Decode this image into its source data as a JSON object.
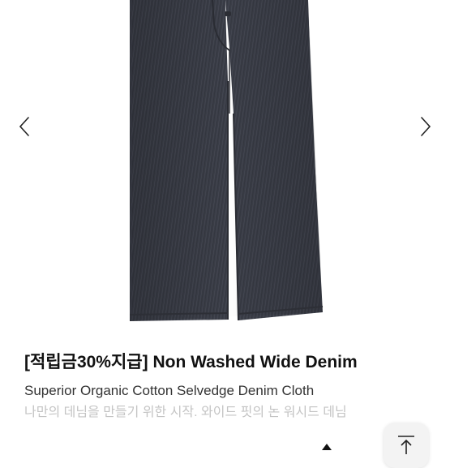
{
  "product": {
    "title": "[적립금30%지급] Non Washed Wide Denim",
    "subtitle": "Superior Organic Cotton Selvedge Denim Cloth",
    "description": "나만의 데님을 만들기 위한 시작. 와이드 핏의 논 워시드 데님"
  },
  "gallery": {
    "image": "dark-raw-denim-wide-pants",
    "prev_icon": "chevron-left-icon",
    "next_icon": "chevron-right-icon"
  },
  "scroll_top": {
    "icon": "arrow-to-top-icon"
  },
  "colors": {
    "denim": "#3a3d47",
    "title": "#111111",
    "subtitle": "#333333",
    "description": "#c4c4c4",
    "button_bg": "#f3f3f3"
  }
}
